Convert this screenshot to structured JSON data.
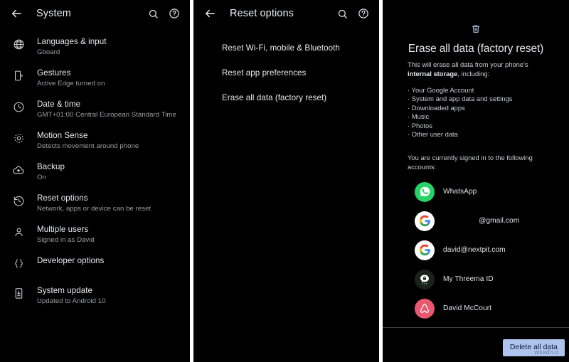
{
  "panel_system": {
    "appbar": {
      "back_icon": "arrow-back-icon",
      "title": "System",
      "search_icon": "search-icon",
      "help_icon": "help-icon"
    },
    "items": [
      {
        "icon": "globe-icon",
        "title": "Languages & input",
        "subtitle": "Gboard"
      },
      {
        "icon": "gesture-icon",
        "title": "Gestures",
        "subtitle": "Active Edge turned on"
      },
      {
        "icon": "clock-icon",
        "title": "Date & time",
        "subtitle": "GMT+01:00 Central European Standard Time"
      },
      {
        "icon": "motion-sense-icon",
        "title": "Motion Sense",
        "subtitle": "Detects movement around phone"
      },
      {
        "icon": "cloud-upload-icon",
        "title": "Backup",
        "subtitle": "On"
      },
      {
        "icon": "history-icon",
        "title": "Reset options",
        "subtitle": "Network, apps or device can be reset"
      },
      {
        "icon": "person-icon",
        "title": "Multiple users",
        "subtitle": "Signed in as David"
      },
      {
        "icon": "braces-icon",
        "title": "Developer options",
        "subtitle": ""
      },
      {
        "icon": "system-update-icon",
        "title": "System update",
        "subtitle": "Updated to Android 10"
      }
    ]
  },
  "panel_reset": {
    "appbar": {
      "back_icon": "arrow-back-icon",
      "title": "Reset options",
      "search_icon": "search-icon",
      "help_icon": "help-icon"
    },
    "items": [
      {
        "label": "Reset Wi-Fi, mobile & Bluetooth"
      },
      {
        "label": "Reset app preferences"
      },
      {
        "label": "Erase all data (factory reset)"
      }
    ]
  },
  "panel_erase": {
    "trash_icon": "trash-icon",
    "title": "Erase all data (factory reset)",
    "body_line1": "This will erase all data from your phone's",
    "body_bold": "internal storage",
    "body_line2": ", including:",
    "bullets": [
      "· Your Google Account",
      "· System and app data and settings",
      "· Downloaded apps",
      "· Music",
      "· Photos",
      "· Other user data"
    ],
    "signed_in_note": "You are currently signed in to the following accounts:",
    "accounts": [
      {
        "icon": "whatsapp-icon",
        "name": "WhatsApp",
        "indent": false
      },
      {
        "icon": "google-icon",
        "name": "@gmail.com",
        "indent": true
      },
      {
        "icon": "google-icon",
        "name": "david@nextpit.com",
        "indent": false
      },
      {
        "icon": "threema-icon",
        "name": "My Threema ID",
        "indent": false
      },
      {
        "icon": "airbnb-icon",
        "name": "David McCourt",
        "indent": false
      }
    ],
    "delete_button": "Delete all data",
    "watermark": "wsxdn.c"
  },
  "colors": {
    "background": "#000000",
    "primary_text": "#e8eaed",
    "secondary_text": "#9aa0a6",
    "button_bg": "#aec4ee",
    "button_text": "#0f1833",
    "whatsapp_green": "#25D366",
    "airbnb_pink": "#e8596f"
  }
}
